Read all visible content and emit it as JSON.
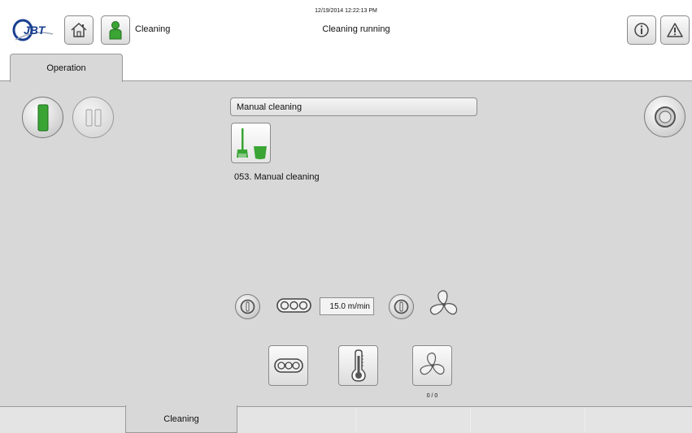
{
  "header": {
    "datetime": "12/19/2014 12:22:13 PM",
    "status": "Cleaning running",
    "user_label": "Cleaning",
    "logo_text": "JBT"
  },
  "tabs": {
    "top": [
      "Operation"
    ],
    "bottom": [
      "Cleaning"
    ]
  },
  "program": {
    "name": "Manual cleaning",
    "step": "053. Manual cleaning",
    "icon": "broom-bucket-icon"
  },
  "controls": {
    "conveyor_speed": "15.0 m/min",
    "fan_count": "0 / 0"
  },
  "colors": {
    "accent_green": "#3aa535",
    "background": "#d8d8d8",
    "header": "#ffffff"
  }
}
